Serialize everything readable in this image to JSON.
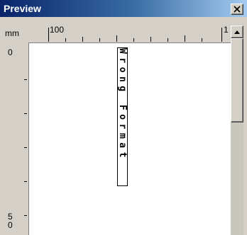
{
  "window": {
    "title": "Preview",
    "close_icon": "close-icon"
  },
  "ruler": {
    "units": "mm",
    "horizontal_labels": [
      "100",
      "1"
    ],
    "vertical_labels": [
      "0",
      "5",
      "0"
    ]
  },
  "preview": {
    "text": "Wrong Format"
  },
  "scrollbar": {
    "up_icon": "arrow-up-icon"
  },
  "colors": {
    "title_start": "#0a246a",
    "title_end": "#a6caf0",
    "face": "#d4d0c8",
    "page": "#ffffff"
  }
}
